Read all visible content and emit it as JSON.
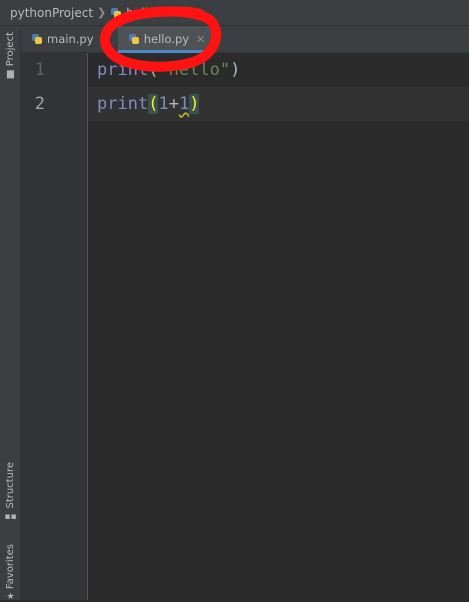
{
  "navbar": {
    "project": "pythonProject",
    "file_partial": "hello"
  },
  "sidebar": {
    "project_label": "Project",
    "structure_label": "Structure",
    "favorites_label": "Favorites"
  },
  "tabs": [
    {
      "label": "main.py",
      "active": false
    },
    {
      "label": "hello.py",
      "active": true
    }
  ],
  "editor": {
    "lines": [
      {
        "number": "1",
        "parts": [
          {
            "text": "print",
            "cls": "kw"
          },
          {
            "text": "(",
            "cls": "op"
          },
          {
            "text": "\"hello\"",
            "cls": "str"
          },
          {
            "text": ")",
            "cls": "op"
          }
        ]
      },
      {
        "number": "2",
        "parts": [
          {
            "text": "print",
            "cls": "kw"
          },
          {
            "text": "(",
            "cls": "brace-hl"
          },
          {
            "text": "1",
            "cls": "num"
          },
          {
            "text": "+",
            "cls": "op"
          },
          {
            "text": "1",
            "cls": "num squiggle"
          },
          {
            "text": ")",
            "cls": "brace-hl"
          }
        ]
      }
    ]
  },
  "colors": {
    "annotation": "#ff1212",
    "tab_underline": "#4a88c7"
  }
}
